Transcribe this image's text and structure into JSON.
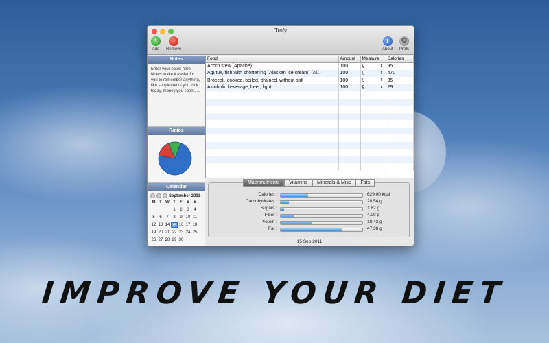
{
  "window": {
    "title": "Trofy"
  },
  "toolbar": {
    "add_label": "Add",
    "remove_label": "Remove",
    "about_label": "About",
    "prefs_label": "Prefs",
    "add_icon": "plus-icon",
    "remove_icon": "minus-icon",
    "about_icon": "info-icon",
    "prefs_icon": "gear-icon"
  },
  "notes": {
    "header": "Notes",
    "placeholder": "Enter your notes here. Notes make it easier for you to remember anything, like supplements you took today, money you spent, ..."
  },
  "ratios": {
    "header": "Ratios",
    "slices": [
      {
        "fraction": 0.72,
        "color": "#2f6fc7"
      },
      {
        "fraction": 0.16,
        "color": "#d8403a"
      },
      {
        "fraction": 0.12,
        "color": "#3fae4e"
      }
    ]
  },
  "calendar": {
    "header": "Calendar",
    "month_label": "September 2011",
    "day_headers": [
      "M",
      "T",
      "W",
      "T",
      "F",
      "S",
      "S"
    ],
    "days": [
      "",
      "",
      "",
      "1",
      "2",
      "3",
      "4",
      "5",
      "6",
      "7",
      "8",
      "9",
      "10",
      "11",
      "12",
      "13",
      "14",
      "15",
      "16",
      "17",
      "18",
      "19",
      "20",
      "21",
      "22",
      "23",
      "24",
      "25",
      "26",
      "27",
      "28",
      "29",
      "30"
    ],
    "selected_day": "15"
  },
  "food_table": {
    "columns": [
      "Food",
      "Amount",
      "Measure",
      "Calories"
    ],
    "rows": [
      {
        "food": "Acorn stew (Apache)",
        "amount": "100",
        "measure": "g",
        "calories": "95"
      },
      {
        "food": "Agutuk, fish with shortening (Alaskan ice cream) (Al...",
        "amount": "100",
        "measure": "g",
        "calories": "470"
      },
      {
        "food": "Broccoli, cooked, boiled, drained, without salt",
        "amount": "100",
        "measure": "g",
        "calories": "35"
      },
      {
        "food": "Alcoholic beverage, beer, light",
        "amount": "100",
        "measure": "g",
        "calories": "29"
      }
    ]
  },
  "summary": {
    "tabs": [
      "Macronutrients",
      "Vitamins",
      "Minerals & Misc",
      "Fats"
    ],
    "active_tab": "Macronutrients",
    "nutrients": [
      {
        "label": "Calories :",
        "value": "629.00 kcal",
        "fraction": 0.34
      },
      {
        "label": "Carbohydrates :",
        "value": "28.54 g",
        "fraction": 0.1
      },
      {
        "label": "Sugars :",
        "value": "1.82 g",
        "fraction": 0.04
      },
      {
        "label": "Fiber :",
        "value": "4.00 g",
        "fraction": 0.16
      },
      {
        "label": "Protein :",
        "value": "18.43 g",
        "fraction": 0.38
      },
      {
        "label": "Fat :",
        "value": "47.38 g",
        "fraction": 0.75
      }
    ]
  },
  "status": {
    "date": "15 Sep 2011"
  },
  "slogan": "IMPROVE YOUR DIET"
}
